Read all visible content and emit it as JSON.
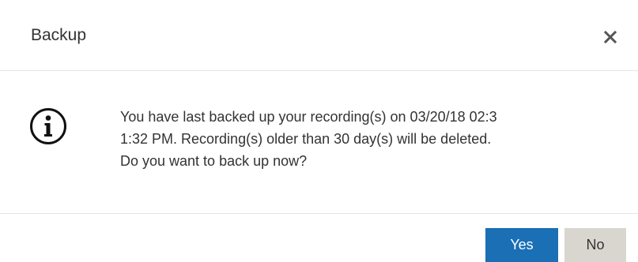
{
  "dialog": {
    "title": "Backup",
    "close_icon": "close-icon",
    "info_icon": "info-circle-icon",
    "message_lines": [
      "You have last backed up your recording(s) on 03/20/18 02:3",
      "1:32 PM. Recording(s) older than 30 day(s) will be deleted.",
      "Do you want to back up now?"
    ],
    "buttons": {
      "yes_label": "Yes",
      "no_label": "No"
    }
  },
  "colors": {
    "primary_button": "#1a6fb5",
    "secondary_button": "#d9d6d0",
    "text": "#333333",
    "divider": "#e5e5e5"
  }
}
